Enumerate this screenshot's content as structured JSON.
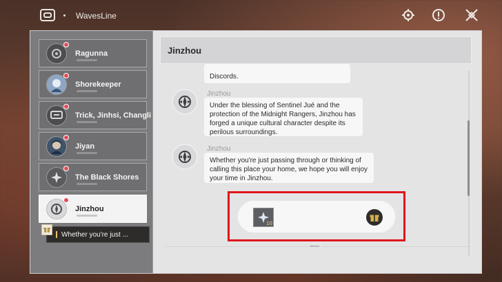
{
  "app": {
    "title": "WavesLine",
    "icons": [
      "chat-logo-icon",
      "gear-icon",
      "alert-icon",
      "close-icon"
    ]
  },
  "sidebar": {
    "contacts": [
      {
        "name": "Ragunna",
        "unread": true,
        "active": false
      },
      {
        "name": "Shorekeeper",
        "unread": true,
        "active": false
      },
      {
        "name": "Trick, Jinhsi, Changli",
        "unread": true,
        "active": false
      },
      {
        "name": "Jiyan",
        "unread": true,
        "active": false
      },
      {
        "name": "The Black Shores",
        "unread": true,
        "active": false
      },
      {
        "name": "Jinzhou",
        "unread": true,
        "active": true
      }
    ],
    "preview": {
      "text": "Whether you're just ..."
    }
  },
  "chat": {
    "title": "Jinzhou",
    "messages": [
      {
        "sender": "",
        "text": "Discords."
      },
      {
        "sender": "Jinzhou",
        "text": "Under the blessing of Sentinel Jué and the protection of the Midnight Rangers, Jinzhou has forged a unique cultural character despite its perilous surroundings."
      },
      {
        "sender": "Jinzhou",
        "text": "Whether you're just passing through or thinking of calling this place your home, we hope you will enjoy your time in Jinzhou."
      }
    ],
    "reward": {
      "item_quantity": "10",
      "item_icon": "crystal-icon",
      "claim_icon": "gift-icon"
    }
  },
  "colors": {
    "highlight": "#e0131b",
    "unread_badge": "#e34a57"
  }
}
